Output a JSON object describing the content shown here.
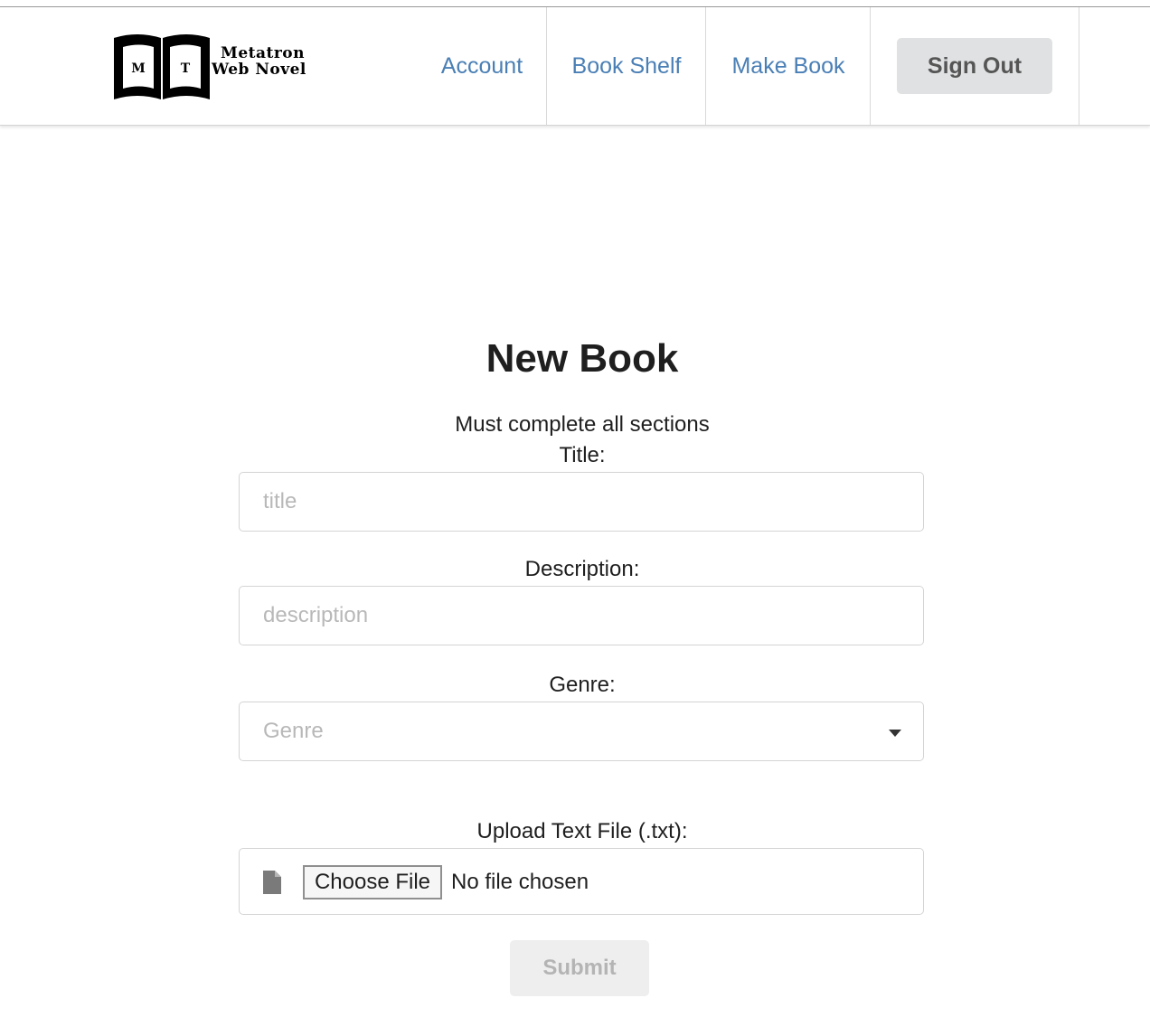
{
  "header": {
    "logo": {
      "line1": "Metatron",
      "line2": "Web Novel",
      "book_letters": [
        "M",
        "T"
      ]
    },
    "nav": [
      {
        "label": "Account"
      },
      {
        "label": "Book Shelf"
      },
      {
        "label": "Make Book"
      }
    ],
    "sign_out_label": "Sign Out",
    "link_color": "#4a7fb5"
  },
  "form": {
    "title": "New Book",
    "subtitle": "Must complete all sections",
    "title_label": "Title:",
    "title_placeholder": "title",
    "description_label": "Description:",
    "description_placeholder": "description",
    "genre_label": "Genre:",
    "genre_placeholder": "Genre",
    "genre_icon": "caret-down-icon",
    "upload_label": "Upload Text File (.txt):",
    "upload_icon": "file-icon",
    "choose_file_label": "Choose File",
    "no_file_text": "No file chosen",
    "submit_label": "Submit",
    "submit_disabled": true
  }
}
